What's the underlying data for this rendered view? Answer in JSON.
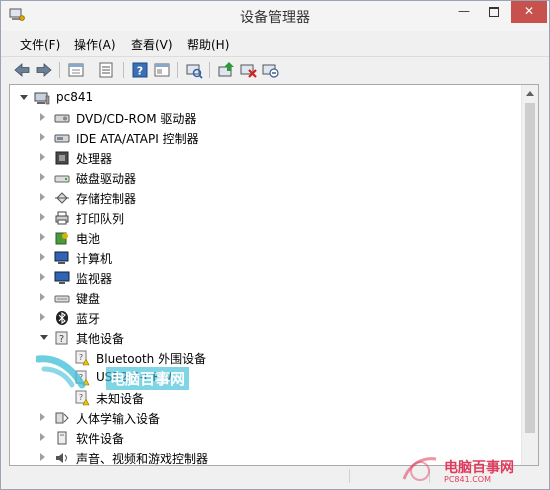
{
  "window": {
    "title": "设备管理器",
    "close_symbol": "✕",
    "min_symbol": "—"
  },
  "menu": [
    {
      "label": "文件(F)"
    },
    {
      "label": "操作(A)"
    },
    {
      "label": "查看(V)"
    },
    {
      "label": "帮助(H)"
    }
  ],
  "toolbar": {
    "buttons": [
      "back-icon",
      "forward-icon",
      "properties-view-icon",
      "device-list-icon",
      "help-icon",
      "show-hide-pane-icon",
      "scan-hardware-icon",
      "update-driver-icon",
      "uninstall-device-icon",
      "disable-device-icon"
    ]
  },
  "tree": {
    "root": "pc841",
    "items": [
      {
        "label": "DVD/CD-ROM 驱动器",
        "icon": "dvd-drive-icon",
        "expanded": false
      },
      {
        "label": "IDE ATA/ATAPI 控制器",
        "icon": "ide-controller-icon",
        "expanded": false
      },
      {
        "label": "处理器",
        "icon": "processor-icon",
        "expanded": false
      },
      {
        "label": "磁盘驱动器",
        "icon": "disk-drive-icon",
        "expanded": false
      },
      {
        "label": "存储控制器",
        "icon": "storage-controller-icon",
        "expanded": false
      },
      {
        "label": "打印队列",
        "icon": "printer-icon",
        "expanded": false
      },
      {
        "label": "电池",
        "icon": "battery-icon",
        "expanded": false
      },
      {
        "label": "计算机",
        "icon": "computer-icon",
        "expanded": false
      },
      {
        "label": "监视器",
        "icon": "monitor-icon",
        "expanded": false
      },
      {
        "label": "键盘",
        "icon": "keyboard-icon",
        "expanded": false
      },
      {
        "label": "蓝牙",
        "icon": "bluetooth-icon",
        "expanded": false
      },
      {
        "label": "其他设备",
        "icon": "other-devices-icon",
        "expanded": true,
        "children": [
          {
            "label": "Bluetooth 外围设备",
            "icon": "unknown-device-warning-icon"
          },
          {
            "label": "USB2.0-CRW",
            "icon": "unknown-device-warning-icon"
          },
          {
            "label": "未知设备",
            "icon": "unknown-device-warning-icon"
          }
        ]
      },
      {
        "label": "人体学输入设备",
        "icon": "hid-icon",
        "expanded": false
      },
      {
        "label": "软件设备",
        "icon": "software-device-icon",
        "expanded": false
      },
      {
        "label": "声音、视频和游戏控制器",
        "icon": "sound-icon",
        "expanded": false
      }
    ]
  },
  "watermark": {
    "overlay_text": "电脑百事网",
    "logo_text": "电脑百事网",
    "logo_sub": "PC841.COM"
  },
  "colors": {
    "accent_close": "#c7514c",
    "watermark_cyan": "#3cbed7",
    "watermark_pink": "#e03a5c",
    "warning_yellow": "#f3c300"
  }
}
